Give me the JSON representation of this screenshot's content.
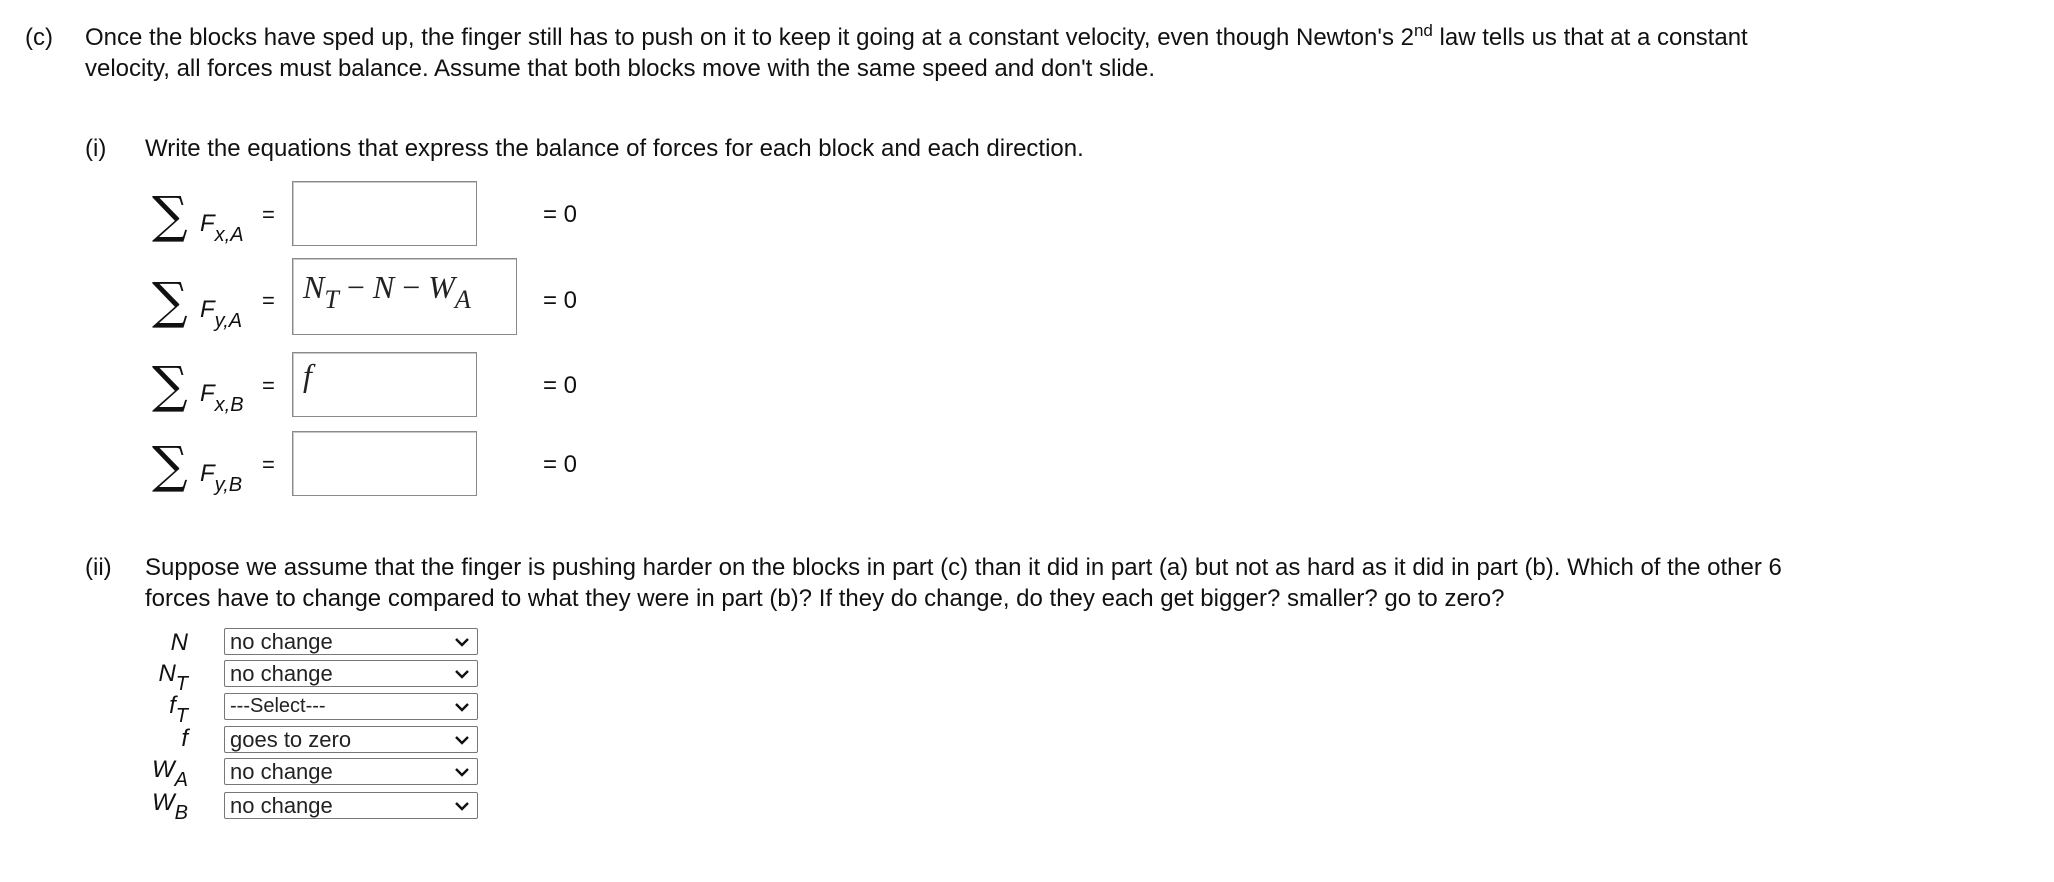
{
  "part_c": {
    "label": "(c)",
    "text_line1": "Once the blocks have sped up, the finger still has to push on it to keep it going at a constant velocity, even though Newton's 2",
    "superscript": "nd",
    "text_line1_tail": " law tells us that at a constant",
    "text_line2": "velocity, all forces must balance. Assume that both blocks move with the same speed and don't slide."
  },
  "part_i": {
    "label": "(i)",
    "text": "Write the equations that express the balance of forces for each block and each direction.",
    "sigma": "∑",
    "equals": "=",
    "zero": "= 0",
    "equations": [
      {
        "force": "F",
        "sub": "x,A",
        "answer_main": "",
        "answer_rest": ""
      },
      {
        "force": "F",
        "sub": "y,A",
        "answer_main": "N",
        "answer_sub1": "T",
        "answer_minus1": " − ",
        "answer_n": "N",
        "answer_minus2": " − ",
        "answer_w": "W",
        "answer_sub2": "A"
      },
      {
        "force": "F",
        "sub": "x,B",
        "answer_main": "f"
      },
      {
        "force": "F",
        "sub": "y,B",
        "answer_main": ""
      }
    ]
  },
  "part_ii": {
    "label": "(ii)",
    "text_line1": "Suppose we assume that the finger is pushing harder on the blocks in part (c) than it did in part (a) but not as hard as it did in part (b). Which of the other 6",
    "text_line2": "forces have to change compared to what they were in part (b)? If they do change, do they each get bigger? smaller? go to zero?",
    "forces": [
      {
        "name": "N",
        "sub": "",
        "selected": "no change"
      },
      {
        "name": "N",
        "sub": "T",
        "selected": "no change"
      },
      {
        "name": "f",
        "sub": "T",
        "selected": "---Select---"
      },
      {
        "name": "f",
        "sub": "",
        "selected": "goes to zero"
      },
      {
        "name": "W",
        "sub": "A",
        "selected": "no change"
      },
      {
        "name": "W",
        "sub": "B",
        "selected": "no change"
      }
    ],
    "dropdown_icon": "chevron-down-icon"
  }
}
